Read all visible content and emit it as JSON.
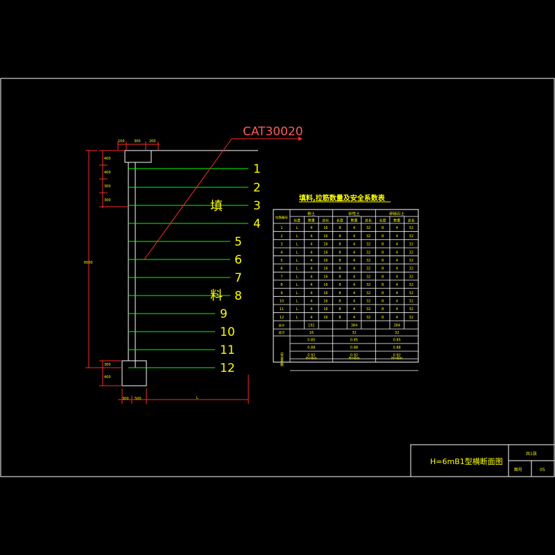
{
  "callout": "CAT30020",
  "fill_chars": [
    "填",
    "料"
  ],
  "reinforcement_rows": [
    {
      "label": "1"
    },
    {
      "label": "2"
    },
    {
      "label": "3"
    },
    {
      "label": "4"
    },
    {
      "label": "5"
    },
    {
      "label": "6"
    },
    {
      "label": "7"
    },
    {
      "label": "8"
    },
    {
      "label": "9"
    },
    {
      "label": "10"
    },
    {
      "label": "11"
    },
    {
      "label": "12"
    }
  ],
  "table": {
    "title": "填料,拉筋数量及安全系数表",
    "corner": "拉筋编号",
    "groups": [
      "粉土",
      "砂性土",
      "碎砾石土"
    ],
    "subheaders": [
      "长度",
      "数量",
      "总长"
    ],
    "rows": [
      [
        "1",
        "L",
        "4",
        "16",
        "8",
        "4",
        "32",
        "8",
        "4",
        "32"
      ],
      [
        "2",
        "L",
        "4",
        "16",
        "8",
        "4",
        "32",
        "8",
        "4",
        "32"
      ],
      [
        "3",
        "L",
        "4",
        "16",
        "8",
        "4",
        "32",
        "8",
        "4",
        "32"
      ],
      [
        "4",
        "L",
        "4",
        "16",
        "8",
        "4",
        "32",
        "8",
        "4",
        "32"
      ],
      [
        "5",
        "L",
        "4",
        "16",
        "8",
        "4",
        "32",
        "8",
        "4",
        "32"
      ],
      [
        "6",
        "L",
        "4",
        "16",
        "8",
        "4",
        "32",
        "8",
        "4",
        "32"
      ],
      [
        "7",
        "L",
        "4",
        "16",
        "8",
        "4",
        "32",
        "8",
        "4",
        "32"
      ],
      [
        "8",
        "L",
        "4",
        "16",
        "8",
        "4",
        "32",
        "8",
        "4",
        "32"
      ],
      [
        "9",
        "L",
        "4",
        "16",
        "8",
        "4",
        "32",
        "8",
        "4",
        "32"
      ],
      [
        "10",
        "L",
        "4",
        "16",
        "8",
        "4",
        "32",
        "8",
        "4",
        "32"
      ],
      [
        "11",
        "L",
        "4",
        "16",
        "8",
        "4",
        "32",
        "8",
        "4",
        "32"
      ],
      [
        "12",
        "L",
        "4",
        "16",
        "8",
        "4",
        "32",
        "8",
        "4",
        "32"
      ]
    ],
    "total_row": {
      "label": "合计",
      "values": [
        "192",
        "384",
        "384"
      ]
    },
    "section2": {
      "row1": {
        "label": "总计",
        "values": [
          "16",
          "32",
          "32"
        ]
      },
      "vertical_label": "安全系数",
      "factor_rows": [
        [
          "0.85",
          "0.85",
          "0.85"
        ],
        [
          "0.88",
          "0.88",
          "0.88"
        ],
        [
          "0.92",
          "0.92",
          "0.92"
        ]
      ],
      "bottom_row": [
        "H=6m",
        "H=6m",
        "H=6m"
      ]
    }
  },
  "dimensions": {
    "top": [
      "100",
      "300",
      "200"
    ],
    "left_top": [
      "400",
      "400",
      "300",
      "300"
    ],
    "left_total": "6000",
    "left_bottom": [
      "300",
      "400"
    ],
    "bottom": [
      "300",
      "500"
    ],
    "bottom_L": "L"
  },
  "title_block": {
    "title": "H=6mB1型横断面图",
    "sheet": "共1张",
    "label": "图号",
    "number": "05"
  },
  "colors": {
    "background": "#000000",
    "lines": "#ffffff",
    "reinforcement": "#00ff00",
    "callout": "#ff2a2a",
    "text": "#ffff00",
    "table_grid": "#ffffff"
  }
}
